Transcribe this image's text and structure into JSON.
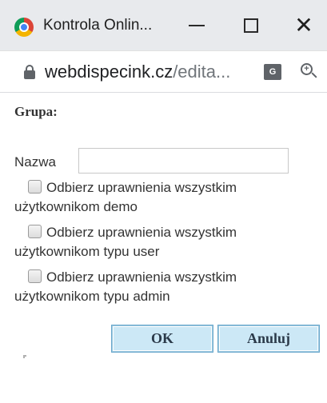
{
  "window": {
    "title": "Kontrola Onlin...",
    "icon": "chrome-icon"
  },
  "address_bar": {
    "domain": "webdispecink.cz",
    "path": "/edita...",
    "translate_label": "G"
  },
  "form": {
    "group_label": "Grupa:",
    "name_label": "Nazwa",
    "name_value": "",
    "options": [
      {
        "label": "Odbierz uprawnienia wszystkim użytkownikom demo",
        "checked": false
      },
      {
        "label": "Odbierz uprawnienia wszystkim użytkownikom typu user",
        "checked": false
      },
      {
        "label": "Odbierz uprawnienia wszystkim użytkownikom typu admin",
        "checked": false
      }
    ],
    "ok_label": "OK",
    "cancel_label": "Anuluj"
  },
  "colors": {
    "button_bg": "#cce8f6",
    "titlebar_bg": "#e8eaed"
  }
}
